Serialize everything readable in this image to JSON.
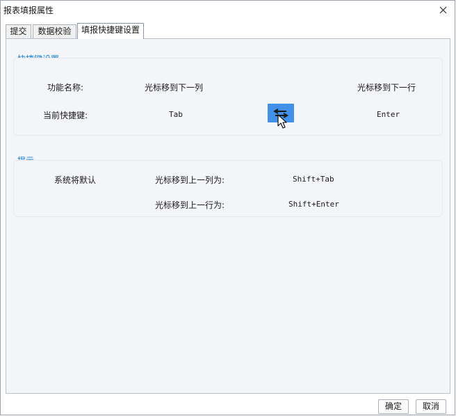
{
  "window": {
    "title": "报表填报属性"
  },
  "tabs": [
    {
      "label": "提交"
    },
    {
      "label": "数据校验"
    },
    {
      "label": "填报快捷键设置",
      "active": true
    }
  ],
  "shortcut_section": {
    "title": "快捷键设置",
    "name_label": "功能名称:",
    "name_value_1": "光标移到下一列",
    "name_value_2": "光标移到下一行",
    "current_label": "当前快捷键:",
    "current_value_1": "Tab",
    "current_value_2": "Enter",
    "swap_icon": "swap-arrows-icon"
  },
  "hint_section": {
    "title": "提示",
    "system_default": "系统将默认",
    "rule_1_label": "光标移到上一列为:",
    "rule_1_value": "Shift+Tab",
    "rule_2_label": "光标移到上一行为:",
    "rule_2_value": "Shift+Enter"
  },
  "footer": {
    "ok_label": "确定",
    "cancel_label": "取消"
  },
  "colors": {
    "accent": "#1780d4",
    "swap_button": "#4191e8",
    "panel_bg": "#f4f5f9"
  }
}
